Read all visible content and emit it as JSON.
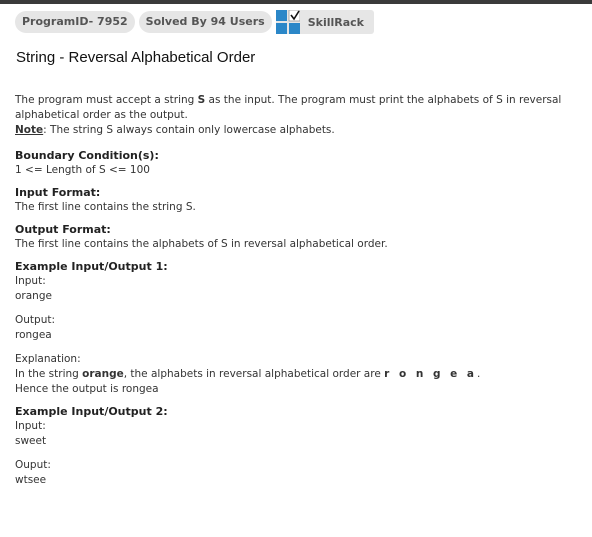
{
  "header": {
    "program_id": "ProgramID- 7952",
    "solved_by": "Solved By 94 Users",
    "brand": "SkillRack"
  },
  "problem": {
    "title": "String - Reversal Alphabetical Order",
    "desc_part1": "The program must accept a string ",
    "desc_s": "S",
    "desc_part2": " as the input. The program must print the alphabets of S in reversal alphabetical order as the output.",
    "note_label": "Note",
    "note_text": ": The string S always contain only lowercase alphabets.",
    "boundary_heading": "Boundary Condition(s):",
    "boundary_text": "1 <= Length of S <= 100",
    "input_format_heading": "Input Format:",
    "input_format_text": "The first line contains the string S.",
    "output_format_heading": "Output Format:",
    "output_format_text": "The first line contains the alphabets of S in reversal alphabetical order.",
    "example1_heading": "Example Input/Output 1:",
    "example1_input_label": "Input:",
    "example1_input": "orange",
    "example1_output_label": "Output:",
    "example1_output": "rongea",
    "explanation_label": "Explanation:",
    "explanation_part1": "In the string ",
    "explanation_word": "orange",
    "explanation_part2": ", the alphabets in reversal alphabetical order are ",
    "explanation_letters": "r o n g e a",
    "explanation_part3": ".",
    "explanation_line2": "Hence the output is rongea",
    "example2_heading": "Example Input/Output 2:",
    "example2_input_label": "Input:",
    "example2_input": "sweet",
    "example2_output_label": "Ouput:",
    "example2_output": "wtsee"
  },
  "colors": {
    "brand_blue": "#2b87c8",
    "badge_bg": "#e6e6e6"
  }
}
